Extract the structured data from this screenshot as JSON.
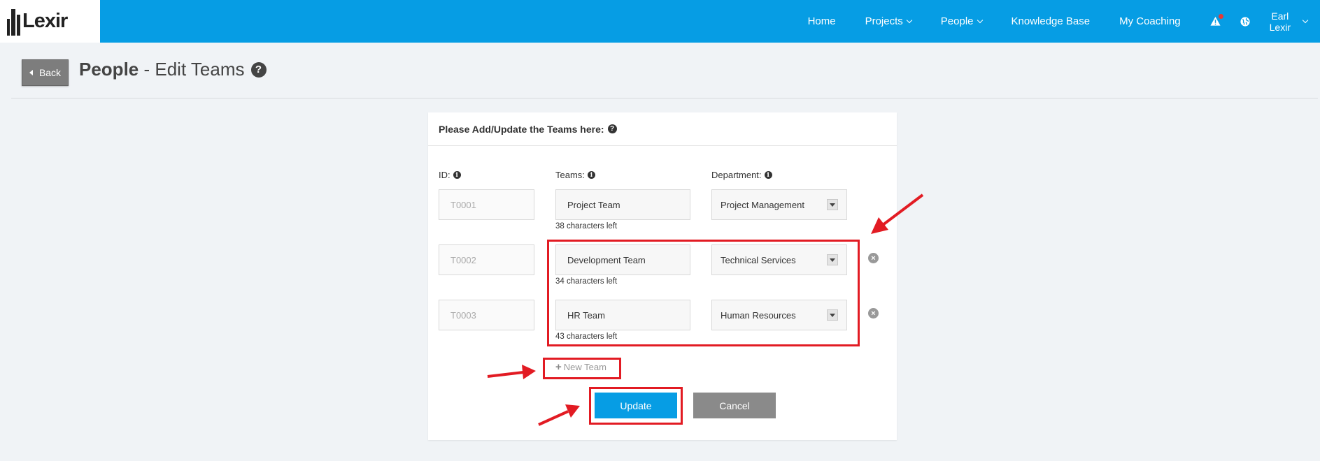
{
  "brand": {
    "logo_text": "Lexir"
  },
  "nav": {
    "home": "Home",
    "projects": "Projects",
    "people": "People",
    "knowledge_base": "Knowledge Base",
    "my_coaching": "My Coaching",
    "user_first": "Earl",
    "user_last": "Lexir"
  },
  "header": {
    "back_label": "Back",
    "section": "People",
    "subtitle": "- Edit Teams",
    "help_glyph": "?"
  },
  "form": {
    "title": "Please Add/Update the Teams here:",
    "col_id": "ID:",
    "col_teams": "Teams:",
    "col_department": "Department:",
    "rows": [
      {
        "id": "T0001",
        "team": "Project Team",
        "department": "Project Management",
        "chars_left": "38 characters left",
        "removable": false
      },
      {
        "id": "T0002",
        "team": "Development Team",
        "department": "Technical Services",
        "chars_left": "34 characters left",
        "removable": true
      },
      {
        "id": "T0003",
        "team": "HR Team",
        "department": "Human Resources",
        "chars_left": "43 characters left",
        "removable": true
      }
    ],
    "new_team_label": "New Team",
    "update_label": "Update",
    "cancel_label": "Cancel"
  },
  "colors": {
    "topbar": "#069de4",
    "primary_button": "#069de4",
    "cancel_button": "#8a8a8a",
    "annotation_red": "#e21b23"
  }
}
